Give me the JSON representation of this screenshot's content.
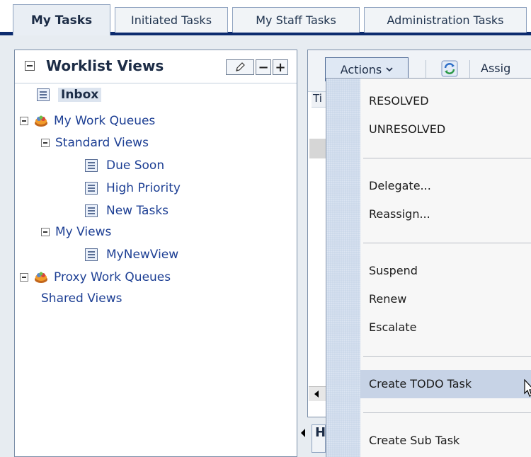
{
  "tabs": [
    {
      "label": "My Tasks",
      "active": true
    },
    {
      "label": "Initiated Tasks",
      "active": false
    },
    {
      "label": "My Staff Tasks",
      "active": false
    },
    {
      "label": "Administration Tasks",
      "active": false
    }
  ],
  "worklist": {
    "title": "Worklist Views",
    "tree": {
      "inbox": "Inbox",
      "my_work_queues": "My Work Queues",
      "standard_views": "Standard Views",
      "due_soon": "Due Soon",
      "high_priority": "High Priority",
      "new_tasks": "New Tasks",
      "my_views": "My Views",
      "my_new_view": "MyNewView",
      "proxy_work_queues": "Proxy Work Queues",
      "shared_views": "Shared Views"
    }
  },
  "toolbar": {
    "actions_label": "Actions",
    "assign_label": "Assig",
    "column_header": "Ti",
    "bottom_tab": "H"
  },
  "actions_menu": {
    "items": [
      "RESOLVED",
      "UNRESOLVED",
      "Delegate...",
      "Reassign...",
      "Suspend",
      "Renew",
      "Escalate",
      "Create TODO Task",
      "Create Sub Task"
    ],
    "highlighted": "Create TODO Task"
  },
  "colors": {
    "tab_underline": "#0c2b6e",
    "link": "#1d3f94",
    "menu_gutter": "#c9d6e9",
    "menu_highlight": "#c7d3e6"
  }
}
